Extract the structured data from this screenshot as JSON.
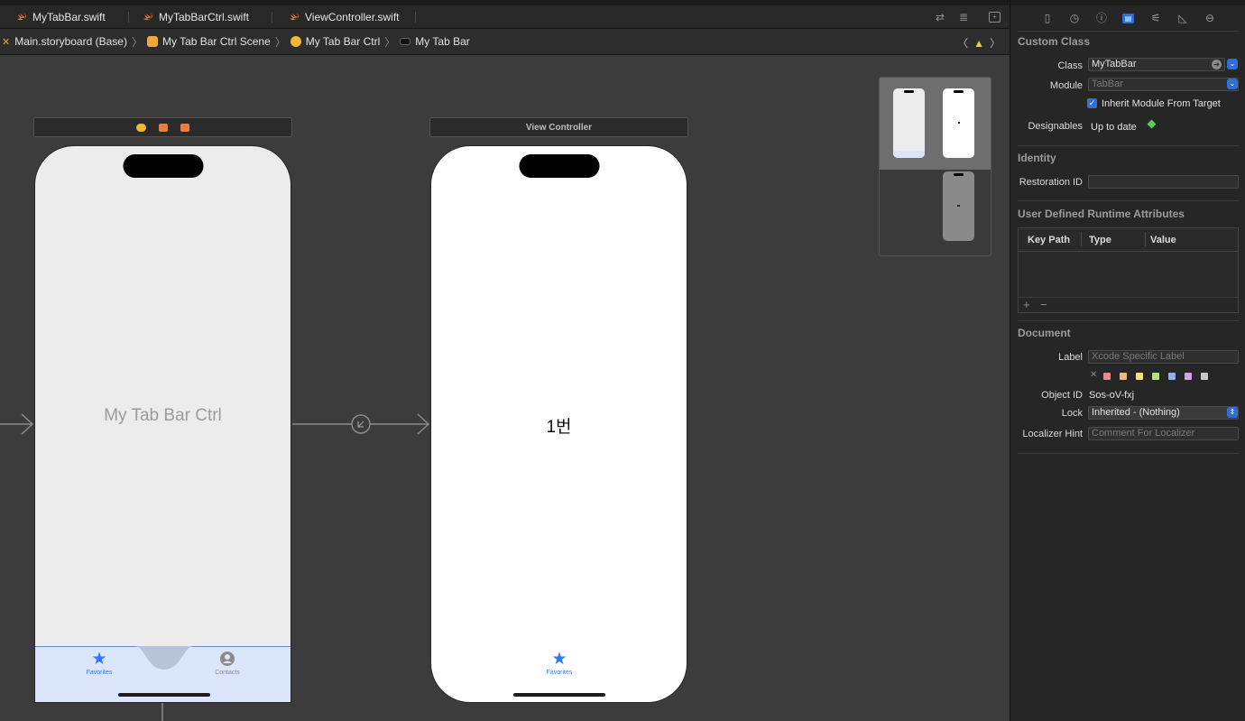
{
  "file_tabs": [
    {
      "label": "MyTabBar.swift"
    },
    {
      "label": "MyTabBarCtrl.swift"
    },
    {
      "label": "ViewController.swift"
    }
  ],
  "breadcrumbs": [
    {
      "label": "Main.storyboard (Base)"
    },
    {
      "label": "My Tab Bar Ctrl Scene"
    },
    {
      "label": "My Tab Bar Ctrl"
    },
    {
      "label": "My Tab Bar"
    }
  ],
  "canvas": {
    "scene1": {
      "title": "My Tab Bar Ctrl",
      "tab_items": [
        {
          "label": "Favorites",
          "icon": "star-icon"
        },
        {
          "label": "Contacts",
          "icon": "person-circle-icon"
        }
      ]
    },
    "scene2": {
      "header": "View Controller",
      "content_label": "1번",
      "tab_item": {
        "label": "Favorites",
        "icon": "star-icon"
      }
    }
  },
  "inspector": {
    "custom_class": {
      "title": "Custom Class",
      "class_label": "Class",
      "class_value": "MyTabBar",
      "module_label": "Module",
      "module_placeholder": "TabBar",
      "inherit_label": "Inherit Module From Target",
      "designables_label": "Designables",
      "designables_value": "Up to date"
    },
    "identity": {
      "title": "Identity",
      "restoration_label": "Restoration ID",
      "restoration_value": ""
    },
    "runtime_attrs": {
      "title": "User Defined Runtime Attributes",
      "columns": [
        "Key Path",
        "Type",
        "Value"
      ],
      "add": "+",
      "remove": "−"
    },
    "document": {
      "title": "Document",
      "label_label": "Label",
      "label_placeholder": "Xcode Specific Label",
      "object_id_label": "Object ID",
      "object_id_value": "Sos-oV-fxj",
      "lock_label": "Lock",
      "lock_value": "Inherited - (Nothing)",
      "hint_label": "Localizer Hint",
      "hint_placeholder": "Comment For Localizer"
    }
  },
  "colors": {
    "accent": "#2f6fd6",
    "tab_blue": "#3478f6",
    "label_swatches": [
      "#e88a8a",
      "#f0b87a",
      "#f2e17a",
      "#b7e27a",
      "#8ab4f0",
      "#d6a2ee",
      "#c8c8c8"
    ]
  }
}
